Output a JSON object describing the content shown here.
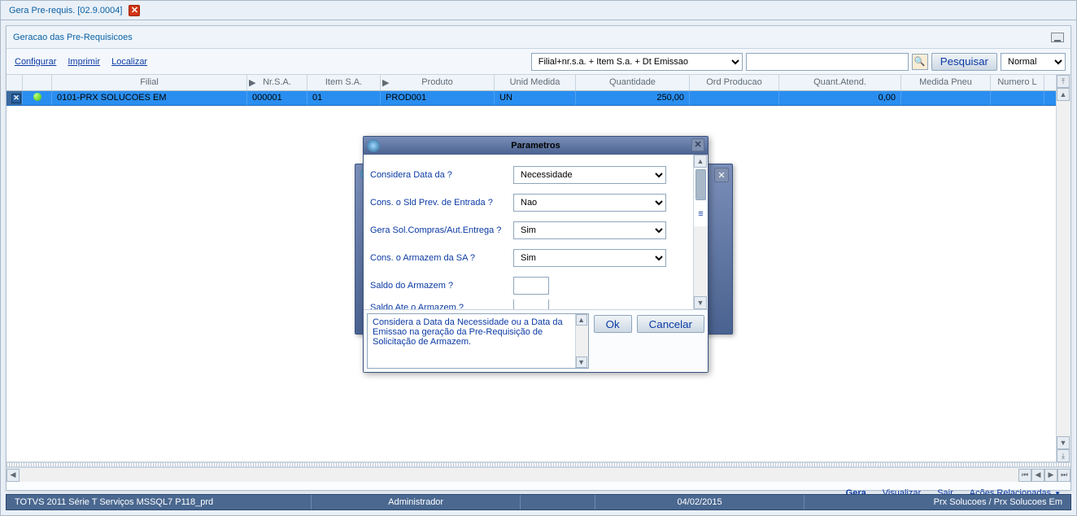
{
  "tab": {
    "title": "Gera Pre-requis. [02.9.0004]"
  },
  "panel": {
    "title": "Geracao das Pre-Requisicoes"
  },
  "toolbar": {
    "configurar": "Configurar",
    "imprimir": "Imprimir",
    "localizar": "Localizar",
    "filter_value": "Filial+nr.s.a. + Item S.a. + Dt Emissao",
    "search_value": "",
    "pesquisar": "Pesquisar",
    "mode_value": "Normal"
  },
  "grid": {
    "columns": [
      "",
      "",
      "Filial",
      "Nr.S.A.",
      "Item S.A.",
      "Produto",
      "Unid Medida",
      "Quantidade",
      "Ord Producao",
      "Quant.Atend.",
      "Medida Pneu",
      "Numero L"
    ],
    "row": {
      "filial": "0101-PRX SOLUCOES EM",
      "nrsa": "000001",
      "item": "01",
      "produto": "PROD001",
      "um": "UN",
      "quantidade": "250,00",
      "ordprod": "",
      "quantatend": "0,00",
      "medpneu": "",
      "numerol": ""
    }
  },
  "bottom_links": {
    "gera": "Gera",
    "visualizar": "Visualizar",
    "sair": "Sair",
    "acoes": "Ações Relacionadas"
  },
  "status": {
    "s1": "TOTVS 2011 Série T Serviços MSSQL7 P118_prd",
    "s2": "Administrador",
    "s3": "04/02/2015",
    "s4": "Prx Solucoes / Prx Solucoes Em"
  },
  "dialog": {
    "title": "Parametros",
    "params": [
      {
        "label": "Considera Data da ?",
        "type": "select",
        "value": "Necessidade"
      },
      {
        "label": "Cons. o Sld Prev. de Entrada ?",
        "type": "select",
        "value": "Nao"
      },
      {
        "label": "Gera Sol.Compras/Aut.Entrega ?",
        "type": "select",
        "value": "Sim"
      },
      {
        "label": "Cons. o Armazem da SA ?",
        "type": "select",
        "value": "Sim"
      },
      {
        "label": "Saldo do Armazem ?",
        "type": "text",
        "value": ""
      },
      {
        "label": "Saldo Ate o Armazem ?",
        "type": "text",
        "value": ""
      }
    ],
    "help": "Considera a Data da Necessidade ou a Data da Emissao na geração da Pre-Requisição de Solicitação de Armazem.",
    "ok": "Ok",
    "cancelar": "Cancelar"
  }
}
